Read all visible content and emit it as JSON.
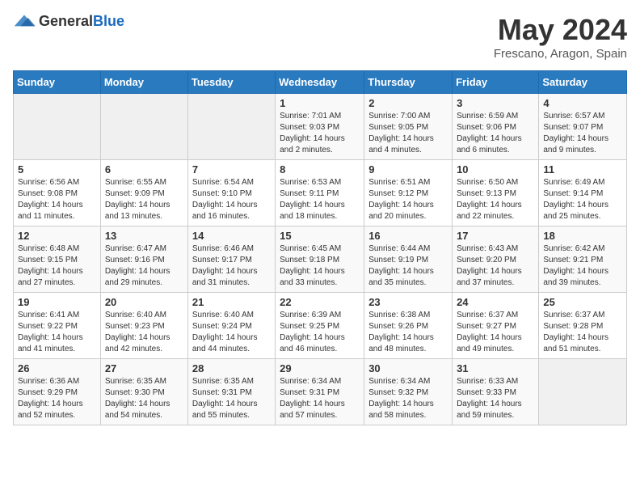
{
  "header": {
    "logo": {
      "general": "General",
      "blue": "Blue"
    },
    "title": "May 2024",
    "location": "Frescano, Aragon, Spain"
  },
  "weekdays": [
    "Sunday",
    "Monday",
    "Tuesday",
    "Wednesday",
    "Thursday",
    "Friday",
    "Saturday"
  ],
  "weeks": [
    [
      {
        "day": "",
        "empty": true
      },
      {
        "day": "",
        "empty": true
      },
      {
        "day": "",
        "empty": true
      },
      {
        "day": "1",
        "sunrise": "7:01 AM",
        "sunset": "9:03 PM",
        "daylight": "14 hours and 2 minutes."
      },
      {
        "day": "2",
        "sunrise": "7:00 AM",
        "sunset": "9:05 PM",
        "daylight": "14 hours and 4 minutes."
      },
      {
        "day": "3",
        "sunrise": "6:59 AM",
        "sunset": "9:06 PM",
        "daylight": "14 hours and 6 minutes."
      },
      {
        "day": "4",
        "sunrise": "6:57 AM",
        "sunset": "9:07 PM",
        "daylight": "14 hours and 9 minutes."
      }
    ],
    [
      {
        "day": "5",
        "sunrise": "6:56 AM",
        "sunset": "9:08 PM",
        "daylight": "14 hours and 11 minutes."
      },
      {
        "day": "6",
        "sunrise": "6:55 AM",
        "sunset": "9:09 PM",
        "daylight": "14 hours and 13 minutes."
      },
      {
        "day": "7",
        "sunrise": "6:54 AM",
        "sunset": "9:10 PM",
        "daylight": "14 hours and 16 minutes."
      },
      {
        "day": "8",
        "sunrise": "6:53 AM",
        "sunset": "9:11 PM",
        "daylight": "14 hours and 18 minutes."
      },
      {
        "day": "9",
        "sunrise": "6:51 AM",
        "sunset": "9:12 PM",
        "daylight": "14 hours and 20 minutes."
      },
      {
        "day": "10",
        "sunrise": "6:50 AM",
        "sunset": "9:13 PM",
        "daylight": "14 hours and 22 minutes."
      },
      {
        "day": "11",
        "sunrise": "6:49 AM",
        "sunset": "9:14 PM",
        "daylight": "14 hours and 25 minutes."
      }
    ],
    [
      {
        "day": "12",
        "sunrise": "6:48 AM",
        "sunset": "9:15 PM",
        "daylight": "14 hours and 27 minutes."
      },
      {
        "day": "13",
        "sunrise": "6:47 AM",
        "sunset": "9:16 PM",
        "daylight": "14 hours and 29 minutes."
      },
      {
        "day": "14",
        "sunrise": "6:46 AM",
        "sunset": "9:17 PM",
        "daylight": "14 hours and 31 minutes."
      },
      {
        "day": "15",
        "sunrise": "6:45 AM",
        "sunset": "9:18 PM",
        "daylight": "14 hours and 33 minutes."
      },
      {
        "day": "16",
        "sunrise": "6:44 AM",
        "sunset": "9:19 PM",
        "daylight": "14 hours and 35 minutes."
      },
      {
        "day": "17",
        "sunrise": "6:43 AM",
        "sunset": "9:20 PM",
        "daylight": "14 hours and 37 minutes."
      },
      {
        "day": "18",
        "sunrise": "6:42 AM",
        "sunset": "9:21 PM",
        "daylight": "14 hours and 39 minutes."
      }
    ],
    [
      {
        "day": "19",
        "sunrise": "6:41 AM",
        "sunset": "9:22 PM",
        "daylight": "14 hours and 41 minutes."
      },
      {
        "day": "20",
        "sunrise": "6:40 AM",
        "sunset": "9:23 PM",
        "daylight": "14 hours and 42 minutes."
      },
      {
        "day": "21",
        "sunrise": "6:40 AM",
        "sunset": "9:24 PM",
        "daylight": "14 hours and 44 minutes."
      },
      {
        "day": "22",
        "sunrise": "6:39 AM",
        "sunset": "9:25 PM",
        "daylight": "14 hours and 46 minutes."
      },
      {
        "day": "23",
        "sunrise": "6:38 AM",
        "sunset": "9:26 PM",
        "daylight": "14 hours and 48 minutes."
      },
      {
        "day": "24",
        "sunrise": "6:37 AM",
        "sunset": "9:27 PM",
        "daylight": "14 hours and 49 minutes."
      },
      {
        "day": "25",
        "sunrise": "6:37 AM",
        "sunset": "9:28 PM",
        "daylight": "14 hours and 51 minutes."
      }
    ],
    [
      {
        "day": "26",
        "sunrise": "6:36 AM",
        "sunset": "9:29 PM",
        "daylight": "14 hours and 52 minutes."
      },
      {
        "day": "27",
        "sunrise": "6:35 AM",
        "sunset": "9:30 PM",
        "daylight": "14 hours and 54 minutes."
      },
      {
        "day": "28",
        "sunrise": "6:35 AM",
        "sunset": "9:31 PM",
        "daylight": "14 hours and 55 minutes."
      },
      {
        "day": "29",
        "sunrise": "6:34 AM",
        "sunset": "9:31 PM",
        "daylight": "14 hours and 57 minutes."
      },
      {
        "day": "30",
        "sunrise": "6:34 AM",
        "sunset": "9:32 PM",
        "daylight": "14 hours and 58 minutes."
      },
      {
        "day": "31",
        "sunrise": "6:33 AM",
        "sunset": "9:33 PM",
        "daylight": "14 hours and 59 minutes."
      },
      {
        "day": "",
        "empty": true
      }
    ]
  ],
  "labels": {
    "sunrise": "Sunrise:",
    "sunset": "Sunset:",
    "daylight": "Daylight:"
  }
}
